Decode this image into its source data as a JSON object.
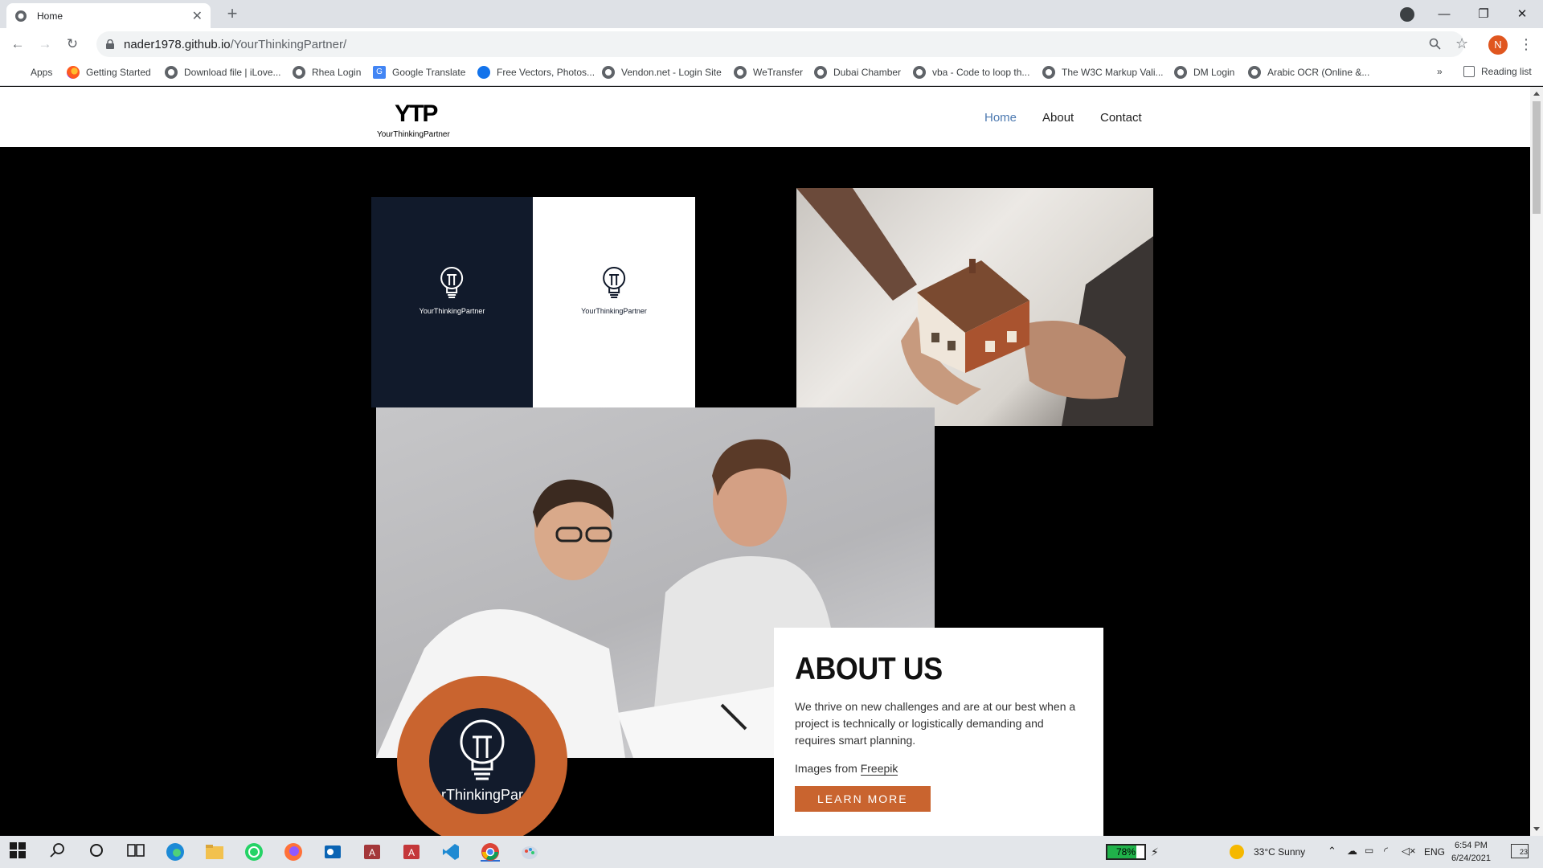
{
  "browser": {
    "tab_title": "Home",
    "tab_close": "✕",
    "new_tab": "+",
    "url_host": "nader1978.github.io",
    "url_path": "/YourThinkingPartner/",
    "profile_initial": "N",
    "reading_list": "Reading list",
    "overflow": "»",
    "window": {
      "minimize": "—",
      "restore": "❐",
      "close": "✕"
    },
    "bookmarks": [
      {
        "label": "Apps",
        "icon": "apps-grid-icon"
      },
      {
        "label": "Getting Started",
        "icon": "firefox-icon"
      },
      {
        "label": "Download file | iLove...",
        "icon": "globe-icon"
      },
      {
        "label": "Rhea Login",
        "icon": "globe-icon"
      },
      {
        "label": "Google Translate",
        "icon": "translate-icon"
      },
      {
        "label": "Free Vectors, Photos...",
        "icon": "freepik-icon"
      },
      {
        "label": "Vendon.net - Login Site",
        "icon": "globe-icon"
      },
      {
        "label": "WeTransfer",
        "icon": "globe-icon"
      },
      {
        "label": "Dubai Chamber",
        "icon": "globe-icon"
      },
      {
        "label": "vba - Code to loop th...",
        "icon": "globe-icon"
      },
      {
        "label": "The W3C Markup Vali...",
        "icon": "globe-icon"
      },
      {
        "label": "DM Login",
        "icon": "globe-icon"
      },
      {
        "label": "Arabic OCR (Online &...",
        "icon": "globe-icon"
      }
    ]
  },
  "site": {
    "logo_mark": "YTP",
    "logo_word": "YourThinkingPartner",
    "nav": [
      {
        "label": "Home",
        "active": true
      },
      {
        "label": "About",
        "active": false
      },
      {
        "label": "Contact",
        "active": false
      }
    ],
    "brand_text": "YourThinkingPartner",
    "circle_text": "rThinkingPar",
    "about": {
      "title": "ABOUT US",
      "text": "We thrive on new challenges and are at our best when a project is technically or logistically demanding and requires smart planning.",
      "credit_prefix": "Images from ",
      "credit_link": "Freepik",
      "button": "LEARN MORE"
    }
  },
  "taskbar": {
    "battery": "78%",
    "battery_fraction": 0.78,
    "weather": "33°C  Sunny",
    "lang": "ENG",
    "time": "6:54 PM",
    "date": "6/24/2021",
    "notifications": "23"
  },
  "colors": {
    "accent_orange": "#c9642f",
    "navy": "#111a2b",
    "nav_active": "#4c79b0"
  }
}
